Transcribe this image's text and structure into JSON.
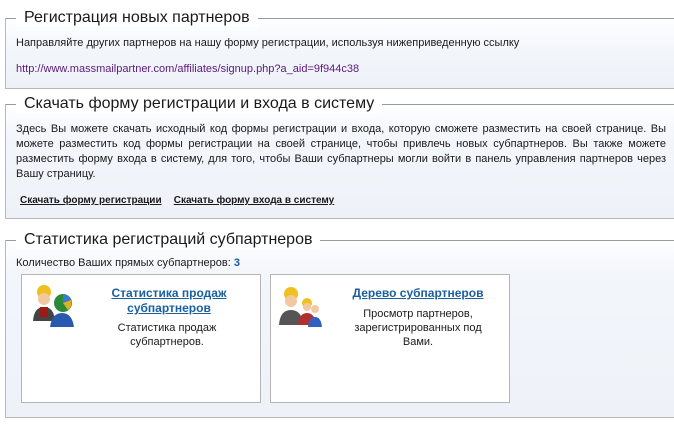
{
  "section1": {
    "title": "Регистрация новых партнеров",
    "description": "Направляйте других партнеров на нашу форму регистрации, используя нижеприведенную ссылку",
    "link": "http://www.massmailpartner.com/affiliates/signup.php?a_aid=9f944c38"
  },
  "section2": {
    "title": "Скачать форму регистрации и входа в систему",
    "description": "Здесь Вы можете скачать исходный код формы регистрации и входа, которую сможете разместить на своей странице. Вы можете разместить код формы регистрации на своей странице, чтобы привлечь новых субпартнеров. Вы также можете разместить форму входа в систему, для того, чтобы Ваши субпартнеры могли войти в панель управления партнеров через Вашу страницу.",
    "links": [
      {
        "label": "Скачать форму регистрации"
      },
      {
        "label": "Скачать форму входа в систему"
      }
    ]
  },
  "section3": {
    "title": "Статистика регистраций субпартнеров",
    "count_label": "Количество Ваших прямых субпартнеров:",
    "count_value": "3",
    "cards": [
      {
        "title_line1": "Статистика продаж",
        "title_line2": "субпартнеров",
        "desc_line1": "Статистика продаж",
        "desc_line2": "субпартнеров.",
        "icon": "users-chart-icon"
      },
      {
        "title_line1": "Дерево субпартнеров",
        "desc_line1": "Просмотр партнеров,",
        "desc_line2": "зарегистрированных под",
        "desc_line3": "Вами.",
        "icon": "users-group-icon"
      }
    ]
  },
  "colors": {
    "link_blue": "#1a5fa0",
    "link_purple": "#5a1a7a",
    "panel_bg": "#eef2f8",
    "border": "#b8b8b8"
  }
}
